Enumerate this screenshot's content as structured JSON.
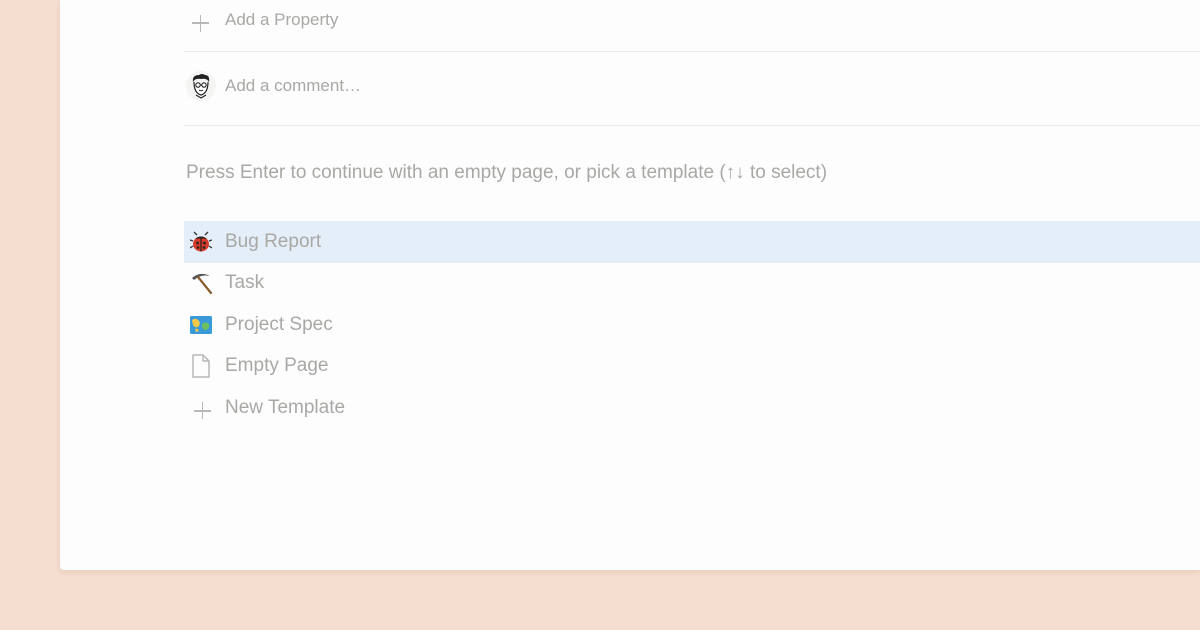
{
  "properties": {
    "add_label": "Add a Property"
  },
  "comment": {
    "placeholder": "Add a comment…"
  },
  "hint": "Press Enter to continue with an empty page, or pick a template (↑↓ to select)",
  "templates": [
    {
      "label": "Bug Report",
      "icon": "ladybug-icon",
      "selected": true
    },
    {
      "label": "Task",
      "icon": "pick-icon",
      "selected": false
    },
    {
      "label": "Project Spec",
      "icon": "map-icon",
      "selected": false
    },
    {
      "label": "Empty Page",
      "icon": "page-icon",
      "selected": false
    },
    {
      "label": "New Template",
      "icon": "plus-icon",
      "selected": false
    }
  ],
  "colors": {
    "background": "#f5ddd0",
    "panel": "#fdfdfd",
    "muted_text": "#a9a8a5",
    "selected_row": "#e4eef8"
  }
}
